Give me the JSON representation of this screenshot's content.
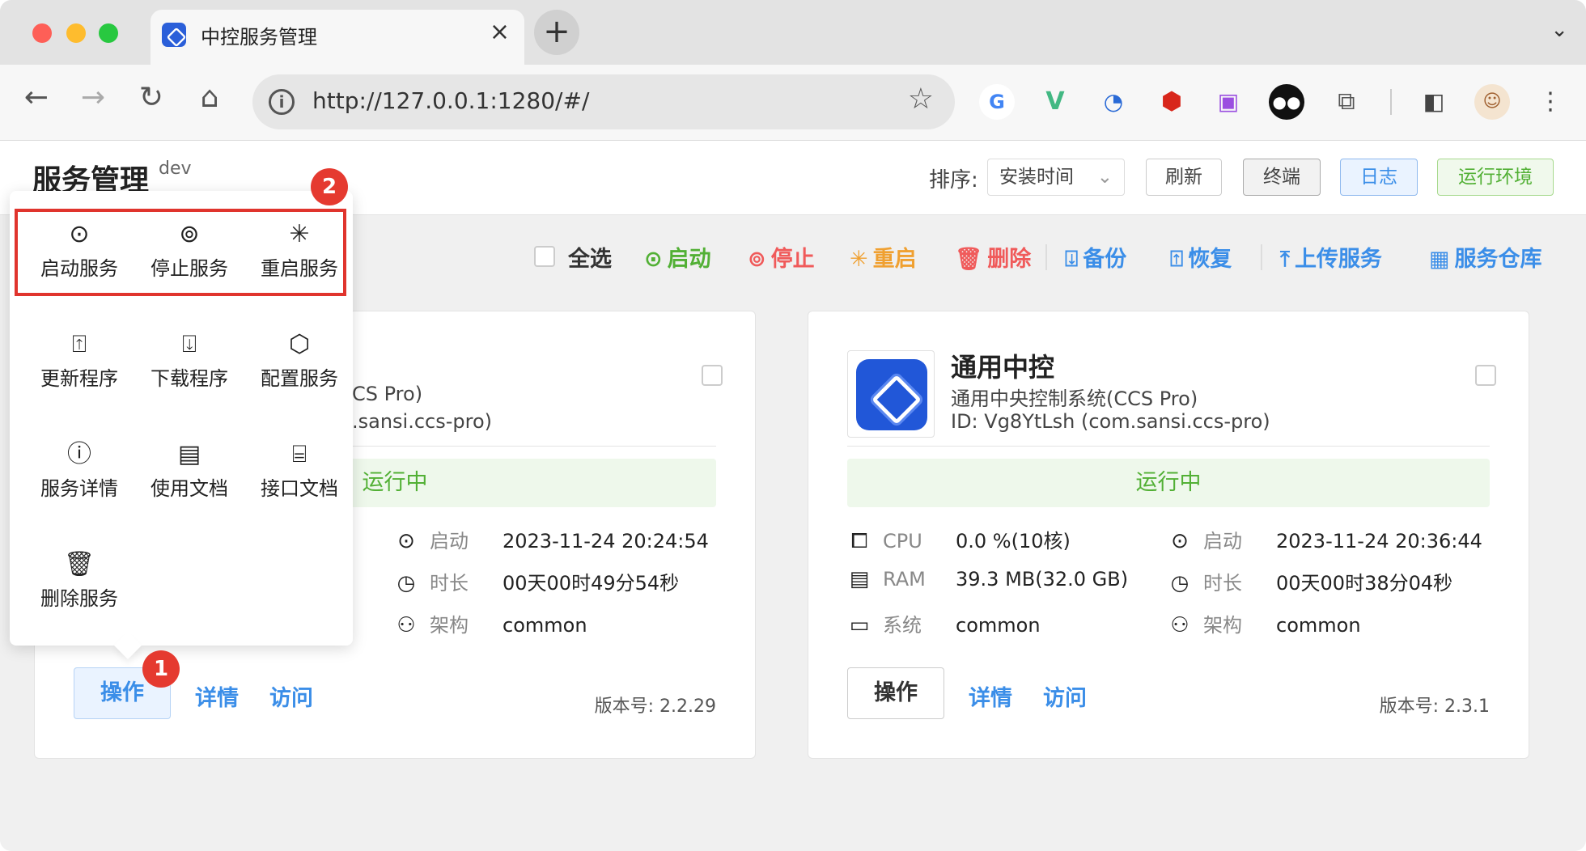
{
  "browser": {
    "tab_title": "中控服务管理",
    "close_glyph": "×",
    "new_tab_glyph": "+",
    "url": "http://127.0.0.1:1280/#/"
  },
  "header": {
    "title": "服务管理",
    "env": "dev",
    "sort_label": "排序:",
    "sort_value": "安装时间",
    "buttons": [
      "刷新",
      "终端",
      "日志",
      "运行环境"
    ]
  },
  "actions": {
    "select_all": "全选",
    "start": "启动",
    "stop": "停止",
    "restart": "重启",
    "delete": "删除",
    "backup": "备份",
    "restore": "恢复",
    "upload": "上传服务",
    "repo": "服务仓库"
  },
  "menu": {
    "items": [
      "启动服务",
      "停止服务",
      "重启服务",
      "更新程序",
      "下载程序",
      "配置服务",
      "服务详情",
      "使用文档",
      "接口文档",
      "删除服务"
    ]
  },
  "annotations": {
    "badge1": "1",
    "badge2": "2"
  },
  "cards": [
    {
      "desc_partial": "CS Pro)",
      "id_partial": ".sansi.ccs-pro)",
      "status": "运行中",
      "start_label": "启动",
      "start_value": "2023-11-24 20:24:54",
      "uptime_label": "时长",
      "uptime_value": "00天00时49分54秒",
      "arch_label": "架构",
      "arch_value": "common",
      "op": "操作",
      "details": "详情",
      "visit": "访问",
      "version": "版本号: 2.2.29"
    },
    {
      "name": "通用中控",
      "desc": "通用中央控制系统(CCS Pro)",
      "id": "ID: Vg8YtLsh (com.sansi.ccs-pro)",
      "status": "运行中",
      "cpu_label": "CPU",
      "cpu_value": "0.0 %(10核)",
      "ram_label": "RAM",
      "ram_value": "39.3 MB(32.0 GB)",
      "sys_label": "系统",
      "sys_value": "common",
      "start_label": "启动",
      "start_value": "2023-11-24 20:36:44",
      "uptime_label": "时长",
      "uptime_value": "00天00时38分04秒",
      "arch_label": "架构",
      "arch_value": "common",
      "op": "操作",
      "details": "详情",
      "visit": "访问",
      "version": "版本号: 2.3.1"
    }
  ]
}
